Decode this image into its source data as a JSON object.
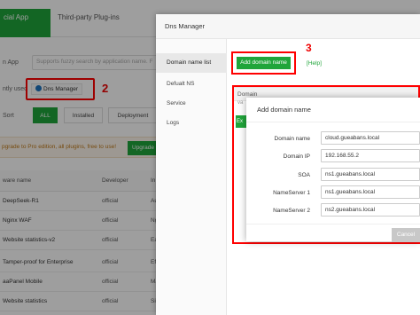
{
  "tabs": {
    "active": "cial App",
    "second": "Third-party Plug-ins"
  },
  "search": {
    "label": "n App",
    "placeholder": "Supports fuzzy search by application name. F"
  },
  "recent": {
    "label": "ntly used",
    "item": "Dns Manager"
  },
  "sort": {
    "label": "Sort",
    "buttons": [
      "ALL",
      "Installed",
      "Deployment"
    ]
  },
  "upgrade": {
    "text": "pgrade to Pro edition, all plugins, free to use!",
    "button": "Upgrade"
  },
  "table": {
    "headers": [
      "ware name",
      "Developer",
      "In"
    ],
    "rows": [
      {
        "name": "DeepSeek-R1",
        "dev": "official",
        "cut": "Au"
      },
      {
        "name": "Nginx WAF",
        "dev": "official",
        "cut": "Ng"
      },
      {
        "name": "Website statistics-v2",
        "dev": "official",
        "cut": "Ea"
      },
      {
        "name": "Tamper-proof for Enterprise",
        "dev": "official",
        "cut": "Eff"
      },
      {
        "name": "aaPanel Mobile",
        "dev": "official",
        "cut": "Ma"
      },
      {
        "name": "Website statistics",
        "dev": "official",
        "cut": "Sit"
      }
    ]
  },
  "annotations": {
    "one": "1",
    "two": "2",
    "three": "3"
  },
  "dns": {
    "title": "Dns Manager",
    "menu": [
      "Domain name list",
      "Defualt NS",
      "Service",
      "Logs"
    ],
    "add_button": "Add domain name",
    "help": "[Help]",
    "domain_header": "Domain",
    "stub_small": "va",
    "stub_green": "Ex"
  },
  "modal": {
    "title": "Add domain name",
    "fields": [
      {
        "label": "Domain name",
        "value": "cloud.gueabans.local"
      },
      {
        "label": "Domain IP",
        "value": "192.168.55.2"
      },
      {
        "label": "SOA",
        "value": "ns1.gueabans.local"
      },
      {
        "label": "NameServer 1",
        "value": "ns1.gueabans.local"
      },
      {
        "label": "NameServer 2",
        "value": "ns2.gueabans.local"
      }
    ],
    "cancel": "Cancel"
  },
  "colors": {
    "accent": "#20a53a",
    "highlight": "#ff0000"
  }
}
